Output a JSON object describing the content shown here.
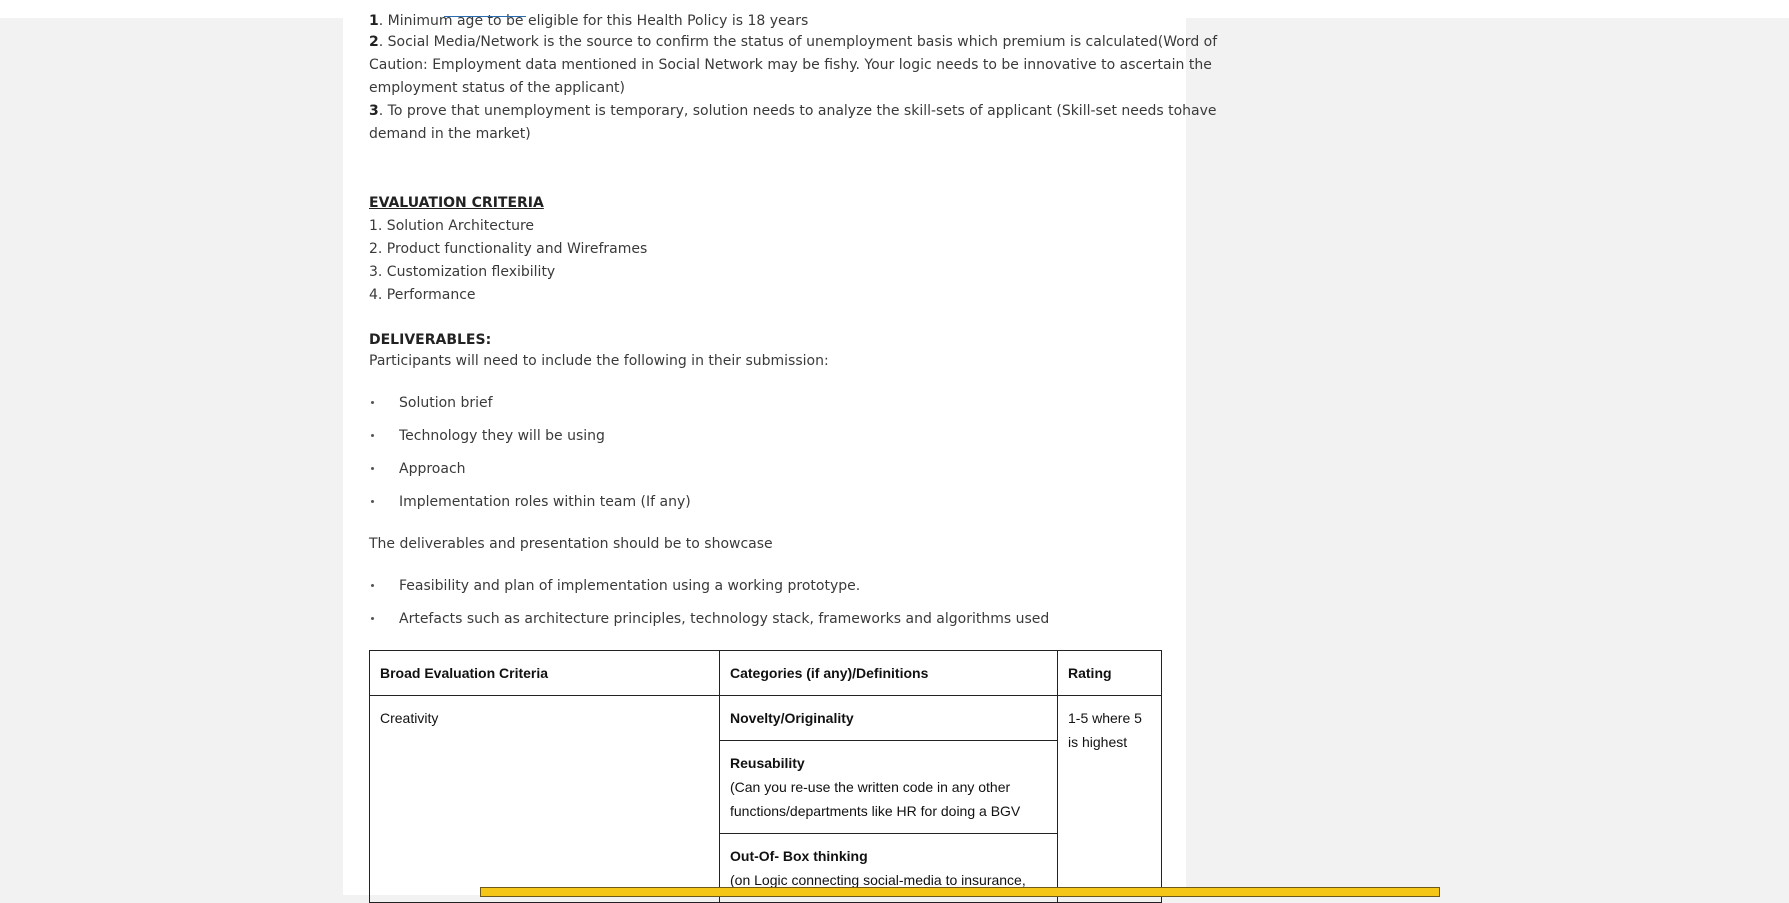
{
  "intro": {
    "line1_num": "1",
    "line1_text": ". Minimum age to be eligible for this Health Policy is 18 years",
    "line2_num": "2",
    "line2_a": ". Social Media/Network is the source to confirm the status of unemployment basis which premium is calculated(Word of",
    "line2_b": "Caution: Employment data mentioned in Social Network may be fishy. Your logic needs to be innovative to ascertain the",
    "line2_c": "employment status of the applicant)",
    "line3_num": "3",
    "line3_a": ". To prove that unemployment is temporary, solution needs to analyze the skill-sets of applicant (Skill-set needs tohave",
    "line3_b": "demand in the market)"
  },
  "evaluation": {
    "heading": "EVALUATION CRITERIA",
    "items": [
      "1. Solution Architecture",
      "2. Product functionality and Wireframes",
      "3. Customization flexibility",
      "4. Performance"
    ]
  },
  "deliverables": {
    "heading": "DELIVERABLES:",
    "intro": "Participants will need to include the following in their submission:",
    "bullets": [
      "Solution brief",
      "Technology they will be using",
      "Approach",
      "Implementation roles within team (If any)"
    ],
    "showcase": "The deliverables and presentation should be to showcase",
    "showcase_bullets": [
      "Feasibility and plan of implementation using a working prototype.",
      "Artefacts such as architecture principles, technology stack, frameworks and algorithms used"
    ]
  },
  "table": {
    "headers": [
      "Broad Evaluation Criteria",
      "Categories (if any)/Definitions",
      "Rating"
    ],
    "row1": {
      "criteria": "Creativity",
      "rating": "1-5 where 5 is highest",
      "categories": [
        {
          "title": "Novelty/Originality",
          "desc": ""
        },
        {
          "title": "Reusability",
          "desc": "(Can you re-use the written code in any other functions/departments like HR for doing a BGV"
        },
        {
          "title": "Out-Of- Box thinking",
          "desc": "(on Logic connecting social-media to insurance,"
        }
      ]
    }
  }
}
